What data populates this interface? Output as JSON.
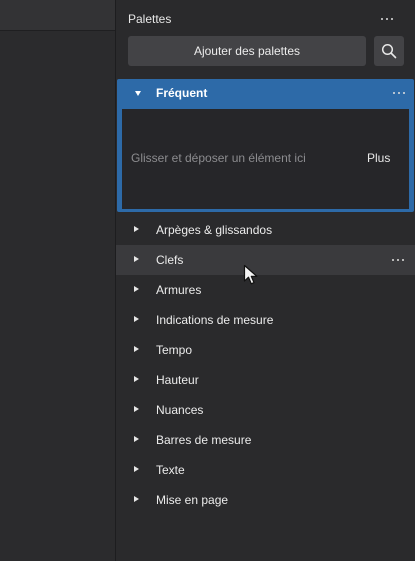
{
  "panel": {
    "title": "Palettes",
    "add_button": "Ajouter des palettes",
    "search_icon": "search-icon"
  },
  "frequent": {
    "label": "Fréquent",
    "drop_hint": "Glisser et déposer un élément ici",
    "more_link": "Plus"
  },
  "palettes": [
    {
      "label": "Arpèges & glissandos"
    },
    {
      "label": "Clefs"
    },
    {
      "label": "Armures"
    },
    {
      "label": "Indications de mesure"
    },
    {
      "label": "Tempo"
    },
    {
      "label": "Hauteur"
    },
    {
      "label": "Nuances"
    },
    {
      "label": "Barres de mesure"
    },
    {
      "label": "Texte"
    },
    {
      "label": "Mise en page"
    }
  ],
  "colors": {
    "accent": "#2d6aa8",
    "background": "#2a2a2c",
    "button": "#434346"
  }
}
